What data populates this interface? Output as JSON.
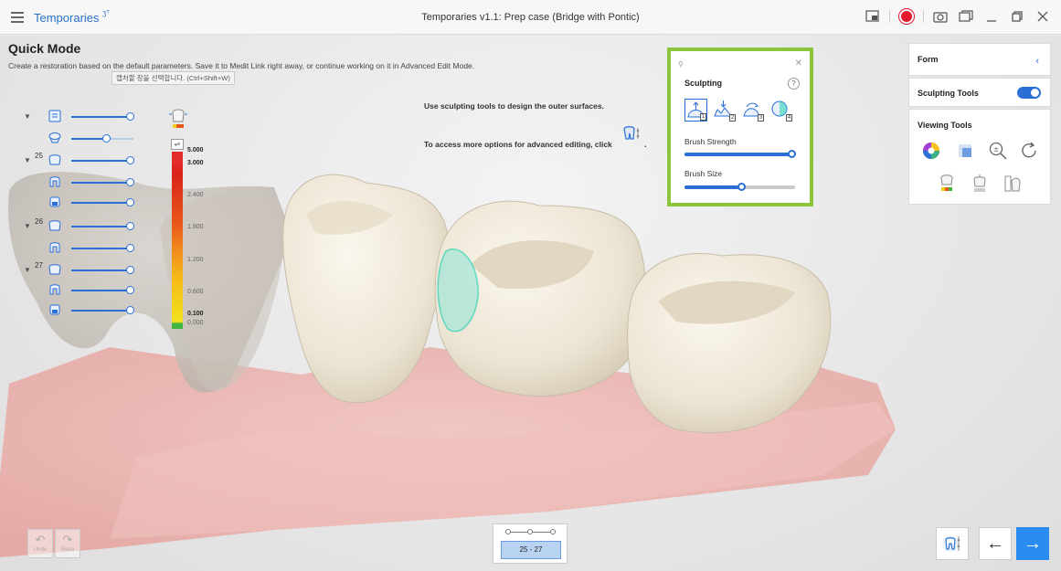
{
  "titlebar": {
    "app_name": "Temporaries",
    "app_badge": "ʒᵀ",
    "window_title": "Temporaries v1.1: Prep case (Bridge with Pontic)"
  },
  "quick_mode": {
    "title": "Quick Mode",
    "description": "Create a restoration based on the default parameters. Save it to Medit Link right away, or continue working on it in Advanced Edit Mode.",
    "tooltip": "캡처할 창을 선택합니다. (Ctrl+Shift+W)"
  },
  "hints": {
    "line1": "Use sculpting tools to design the outer surfaces.",
    "line2": "To access more options for advanced editing, click",
    "line2_suffix": "."
  },
  "visibility": {
    "tooth_numbers": [
      "25",
      "26",
      "27"
    ],
    "levels": [
      1.0,
      0.55,
      1.0,
      1.0,
      1.0,
      1.0,
      1.0,
      1.0,
      1.0,
      1.0
    ]
  },
  "color_scale": {
    "labels": [
      "5.000",
      "3.000",
      "2.400",
      "1.800",
      "1.200",
      "0.600",
      "0.100",
      "0.000"
    ]
  },
  "sculpting": {
    "title": "Sculpting",
    "help": "?",
    "tool_keys": [
      "1",
      "2",
      "3",
      "4"
    ],
    "brush_strength_label": "Brush Strength",
    "brush_strength": 1.0,
    "brush_size_label": "Brush Size",
    "brush_size": 0.5
  },
  "right_panel": {
    "form_label": "Form",
    "form_chevron": "‹",
    "sculpting_tools_label": "Sculpting Tools",
    "sculpting_tools_enabled": true,
    "viewing_tools_label": "Viewing Tools"
  },
  "bottom": {
    "undo_label": "Undo",
    "redo_label": "Redo",
    "range": "25 - 27",
    "prev_arrow": "←",
    "next_arrow": "→"
  },
  "colors": {
    "accent": "#2a6fd6",
    "highlight_frame": "#8cc43c",
    "title_blue": "#2a72c9",
    "record_red": "#e0192b"
  }
}
